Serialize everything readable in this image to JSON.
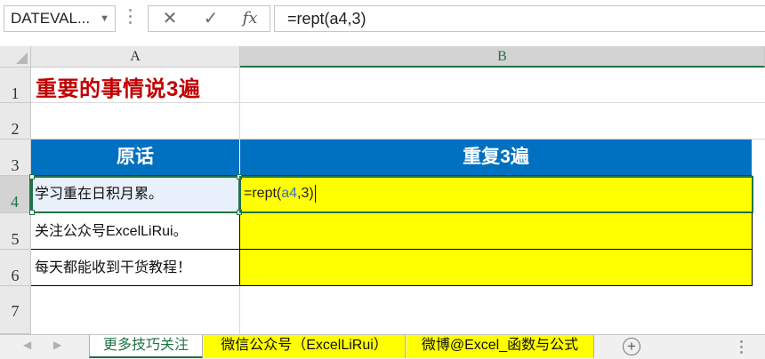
{
  "formula_bar": {
    "name_box": "DATEVAL...",
    "cancel_icon": "✕",
    "enter_icon": "✓",
    "fx_label": "fx",
    "formula": "=rept(a4,3)"
  },
  "columns": [
    "A",
    "B"
  ],
  "rows": [
    "1",
    "2",
    "3",
    "4",
    "5",
    "6",
    "7"
  ],
  "sheet": {
    "title": "重要的事情说3遍",
    "header_a": "原话",
    "header_b": "重复3遍",
    "a4": "学习重在日积月累。",
    "a5": "关注公众号ExcelLiRui。",
    "a6": "每天都能收到干货教程！",
    "b4_edit": {
      "pre": "=rept(",
      "ref": "a4",
      "post": ",3)"
    }
  },
  "tabs": [
    {
      "label": "更多技巧关注",
      "active": true
    },
    {
      "label": "微信公众号（ExcelLiRui）",
      "active": false
    },
    {
      "label": "微博@Excel_函数与公式",
      "active": false
    }
  ],
  "colors": {
    "header_fill": "#0070c0",
    "highlight_fill": "#ffff00",
    "title_color": "#c00000",
    "selection": "#217346"
  }
}
